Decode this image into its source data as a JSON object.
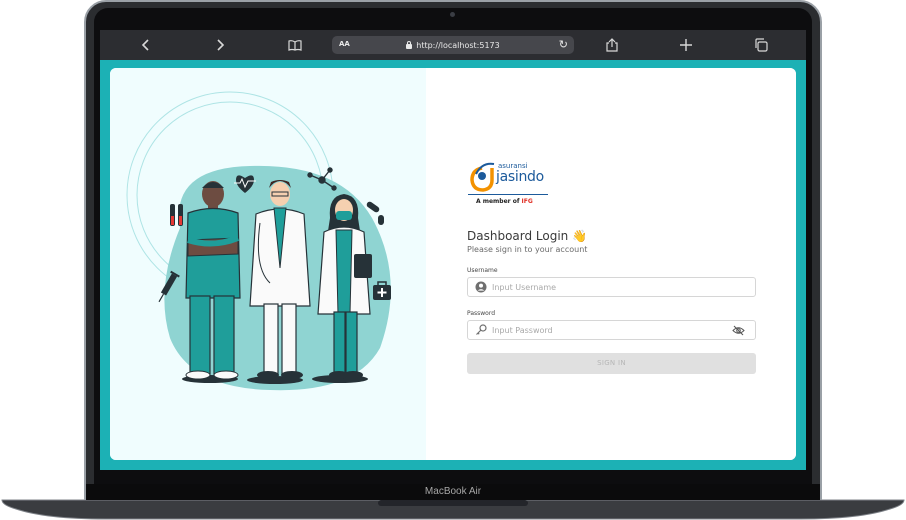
{
  "browser": {
    "url_text": "http://localhost:5173",
    "text_size_label": "AA",
    "back_icon": "chevron-left-icon",
    "forward_icon": "chevron-right-icon",
    "bookmarks_icon": "book-icon",
    "share_icon": "share-icon",
    "new_tab_icon": "plus-icon",
    "tabs_icon": "tabs-icon"
  },
  "brand": {
    "line1": "asuransi",
    "line2": "jasindo",
    "member_prefix": "A member of",
    "member_brand": "IFG",
    "color": "#1c5a9b"
  },
  "login": {
    "title": "Dashboard Login 👋",
    "subtitle": "Please sign in to your account",
    "username_label": "Username",
    "username_placeholder": "Input Username",
    "password_label": "Password",
    "password_placeholder": "Input Password",
    "signin_label": "SIGN IN"
  },
  "device": {
    "model_label": "MacBook Air"
  },
  "colors": {
    "teal": "#1cb1b5",
    "illustration_bg": "#f0fdfe"
  }
}
